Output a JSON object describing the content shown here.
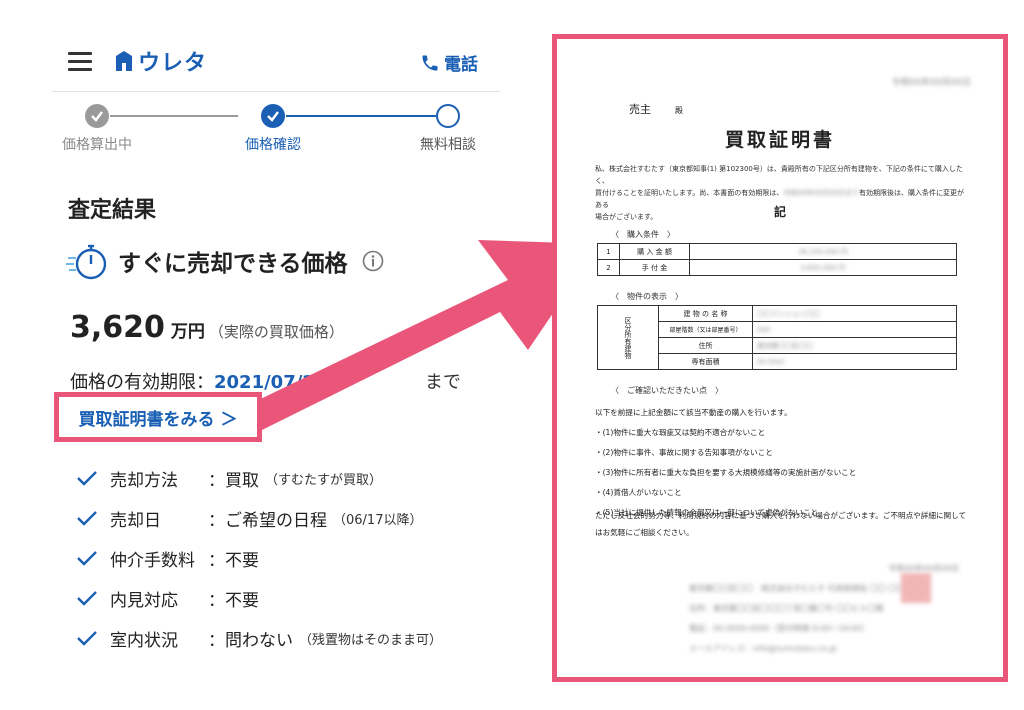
{
  "header": {
    "logo_text": "ウレタ",
    "phone_label": "電話"
  },
  "steps": [
    {
      "label": "価格算出中",
      "state": "done",
      "color": "#9a9a9a"
    },
    {
      "label": "価格確認",
      "state": "done",
      "color": "#1a5fb4"
    },
    {
      "label": "無料相談",
      "state": "pending",
      "color": "#1a5fb4"
    }
  ],
  "result": {
    "section_title": "査定結果",
    "price_heading": "すぐに売却できる価格",
    "price_amount": "3,620",
    "price_unit": "万円",
    "price_note": "（実際の買取価格）",
    "validity_label": "価格の有効期限：",
    "validity_date": "2021/07/2",
    "validity_suffix": "まで",
    "cert_link": "買取証明書をみる ＞"
  },
  "conditions": [
    {
      "label": "売却方法",
      "value": "：買取",
      "note": "（すむたすが買取）"
    },
    {
      "label": "売却日",
      "value": "：ご希望の日程",
      "note": "（06/17以降）"
    },
    {
      "label": "仲介手数料",
      "value": "：不要",
      "note": ""
    },
    {
      "label": "内見対応",
      "value": "：不要",
      "note": ""
    },
    {
      "label": "室内状況",
      "value": "：問わない",
      "note": "（残置物はそのまま可）"
    }
  ],
  "certificate": {
    "date": "令和00年00月00日",
    "addressee_label": "売主",
    "addressee_suffix": "殿",
    "title": "買取証明書",
    "intro_1": "私、株式会社すむたす（東京都知事(1) 第102300号）は、貴殿所有の下記区分所有建物を、下記の条件にて購入したく、",
    "intro_2": "買付けることを証明いたします。尚、本書面の有効期限は、",
    "intro_blur": "令和00年00月00日まで",
    "intro_3": "有効期限後は、購入条件に変更がある",
    "intro_4": "場合がございます。",
    "ki": "記",
    "purchase_heading": "〈　購入条件　〉",
    "purchase_rows": [
      {
        "no": "1",
        "label": "購 入 金 額",
        "value": "36,200,000 円"
      },
      {
        "no": "2",
        "label": "手 付 金",
        "value": "3,600,000 円"
      }
    ],
    "property_heading": "〈　物件の表示　〉",
    "property_side": "区分所有建物",
    "property_rows": [
      {
        "label": "建 物 の 名 称",
        "value": "〇〇マンション〇〇"
      },
      {
        "label": "部屋階数（又は部屋番号）",
        "value": "000"
      },
      {
        "label": "住所",
        "value": "東京都〇〇区〇〇"
      },
      {
        "label": "専有面積",
        "value": "00.00㎡"
      }
    ],
    "confirm_heading": "〈　ご確認いただきたい点　〉",
    "confirm_items": [
      "以下を前提に上記金額にて該当不動産の購入を行います。",
      "・(1)物件に重大な瑕疵又は契約不適合がないこと",
      "・(2)物件に事件、事故に関する告知事項がないこと",
      "・(3)物件に所有者に重大な負担を要する大規模修繕等の実施計画がないこと",
      "・(4)賃借人がいないこと",
      "・(5)当社に提供した情報の全部又は一部について虚偽がないこと"
    ],
    "closing": "ただし反社会的勢力等、利用規約の内容に基づき購入を行わない場合がございます。ご不明点や詳細に関してはお気軽にご相談ください。",
    "footer_lines": [
      "令和00年00月00日",
      "東京都〇〇区〇〇　株式会社すむたす 代表取締役 〇〇 〇〇",
      "住所：東京都〇〇区〇〇〇丁目〇番〇号 〇〇ビル〇階",
      "電話：00-0000-0000（受付時間 9:00〜18:00）",
      "メールアドレス：info@sumutasu.co.jp"
    ]
  },
  "colors": {
    "accent_blue": "#1a5fb4",
    "highlight_pink": "#e9567a"
  }
}
